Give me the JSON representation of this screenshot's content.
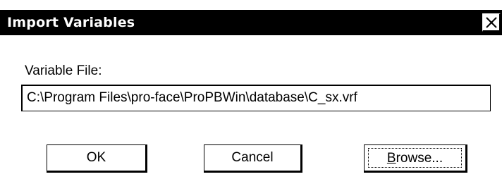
{
  "window": {
    "title": "Import Variables",
    "close_icon": "close-icon"
  },
  "form": {
    "variable_file_label": "Variable File:",
    "variable_file_value": "C:\\Program Files\\pro-face\\ProPBWin\\database\\C_sx.vrf"
  },
  "buttons": {
    "ok_label": "OK",
    "cancel_label": "Cancel",
    "browse_mnemonic": "B",
    "browse_rest": "rowse..."
  },
  "colors": {
    "titlebar": "#000000",
    "title_text": "#ffffff",
    "background": "#ffffff"
  }
}
